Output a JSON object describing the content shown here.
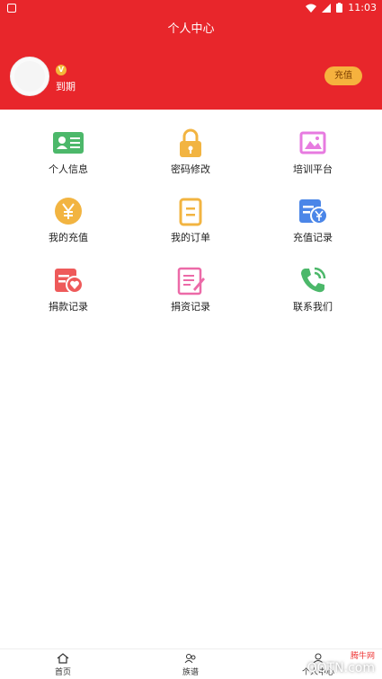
{
  "statusbar": {
    "time": "11:03"
  },
  "header": {
    "title": "个人中心"
  },
  "profile": {
    "vip_badge": "V",
    "expire_text": "到期",
    "recharge_label": "充值"
  },
  "menu": {
    "items": [
      {
        "label": "个人信息",
        "icon": "id-card-icon"
      },
      {
        "label": "密码修改",
        "icon": "lock-icon"
      },
      {
        "label": "培训平台",
        "icon": "image-frame-icon"
      },
      {
        "label": "我的充值",
        "icon": "yen-coin-icon"
      },
      {
        "label": "我的订单",
        "icon": "order-icon"
      },
      {
        "label": "充值记录",
        "icon": "recharge-record-icon"
      },
      {
        "label": "捐款记录",
        "icon": "donation-record-icon"
      },
      {
        "label": "捐资记录",
        "icon": "edit-note-icon"
      },
      {
        "label": "联系我们",
        "icon": "phone-icon"
      }
    ]
  },
  "bottom_nav": {
    "items": [
      {
        "label": "首页",
        "icon": "home-icon"
      },
      {
        "label": "族谱",
        "icon": "family-tree-icon"
      },
      {
        "label": "个人中心",
        "icon": "user-icon"
      }
    ]
  },
  "watermark": {
    "brand": "QQTN.com",
    "site": "腾牛网"
  }
}
